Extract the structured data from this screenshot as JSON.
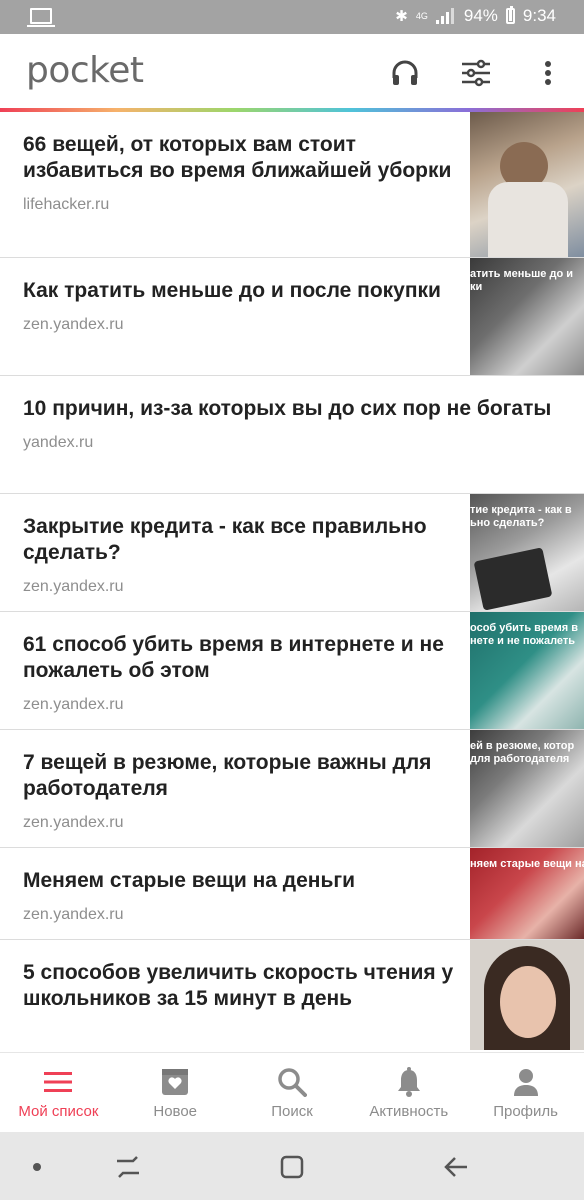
{
  "status_bar": {
    "battery": "94%",
    "time": "9:34",
    "network": "4G"
  },
  "app_bar": {
    "logo": "pocket",
    "icons": [
      "headphones-icon",
      "filter-sliders-icon",
      "more-vert-icon"
    ]
  },
  "articles": [
    {
      "title": "66 вещей, от которых вам стоит избавиться во время ближайшей уборки",
      "domain": "lifehacker.ru",
      "thumb_caption": ""
    },
    {
      "title": "Как тратить меньше до и после покупки",
      "domain": "zen.yandex.ru",
      "thumb_caption": "атить меньше до и\nки"
    },
    {
      "title": "10 причин, из-за которых вы до сих пор не богаты",
      "domain": "yandex.ru",
      "thumb_caption": ""
    },
    {
      "title": "Закрытие кредита - как все правильно сделать?",
      "domain": "zen.yandex.ru",
      "thumb_caption": "тие кредита - как в\nьно сделать?"
    },
    {
      "title": "61 способ убить время в интернете и не пожалеть об этом",
      "domain": "zen.yandex.ru",
      "thumb_caption": "особ убить время в\nнете и не пожалеть"
    },
    {
      "title": "7 вещей в резюме, которые важны для работодателя",
      "domain": "zen.yandex.ru",
      "thumb_caption": "ей в резюме, котор\nдля работодателя"
    },
    {
      "title": "Меняем старые вещи на деньги",
      "domain": "zen.yandex.ru",
      "thumb_caption": "няем старые вещи на деньги"
    },
    {
      "title": "5 способов увеличить скорость чтения у школьников за 15 минут в день",
      "domain": "",
      "thumb_caption": ""
    }
  ],
  "bottom_nav": [
    {
      "label": "Мой список",
      "icon": "list-icon",
      "active": true
    },
    {
      "label": "Новое",
      "icon": "inbox-heart-icon",
      "active": false
    },
    {
      "label": "Поиск",
      "icon": "search-icon",
      "active": false
    },
    {
      "label": "Активность",
      "icon": "bell-icon",
      "active": false
    },
    {
      "label": "Профиль",
      "icon": "person-icon",
      "active": false
    }
  ],
  "colors": {
    "accent": "#ef4056",
    "status_bar": "#a3a3a3",
    "nav_inactive": "#8c8c8c",
    "domain_text": "#8e8e8e"
  }
}
